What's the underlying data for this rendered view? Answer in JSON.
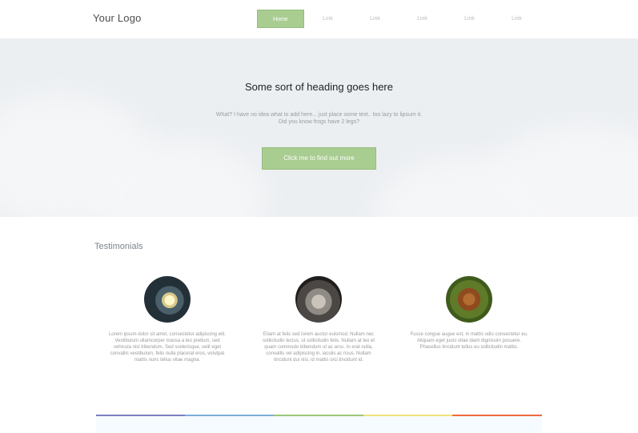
{
  "header": {
    "logo": "Your Logo",
    "nav": [
      {
        "label": "Home",
        "active": true
      },
      {
        "label": "Link",
        "active": false
      },
      {
        "label": "Link",
        "active": false
      },
      {
        "label": "Link",
        "active": false
      },
      {
        "label": "Link",
        "active": false
      },
      {
        "label": "Link",
        "active": false
      }
    ]
  },
  "hero": {
    "heading": "Some sort of heading goes here",
    "text_line1": "What? I have no idea what to add here... just place some text.. too lazy to lipsum it.",
    "text_line2": "Did you know frogs have 2 legs?",
    "button": "Click me to find out more"
  },
  "testimonials": {
    "title": "Testimonials",
    "items": [
      {
        "text": "Lorem ipsum dolor sit amet, consectetur adipiscing elit. Vestibulum ullamcorper massa a leo pretium, sed vehicula nisl bibendum. Sed scelerisque, velit eget convallis vestibulum, felis nulla placerat eros, volutpat mattis nunc tellus vitae magna."
      },
      {
        "text": "Etiam at felis sed lorem auctor euismod. Nullam nec sollicitudin lectus, ut sollicitudin felis. Nullam at leo et quam commodo bibendum ut ac arcu. In erat nulla, convallis vel adipiscing in, iaculis ac risus. Nullam tincidunt dui nisi, id mattis orci tincidunt id."
      },
      {
        "text": "Fusce congue augue est, in mattis odio consectetur eu. Aliquam eget justo vitae diam dignissim posuere. Phasellus tincidunt tellus eu sollicitudin mattis."
      }
    ]
  },
  "colors": {
    "accent": "#a9cc90",
    "stripe": [
      "#7a7fc2",
      "#7aaed6",
      "#9cc77b",
      "#f0e27a",
      "#ef6a3c"
    ]
  }
}
